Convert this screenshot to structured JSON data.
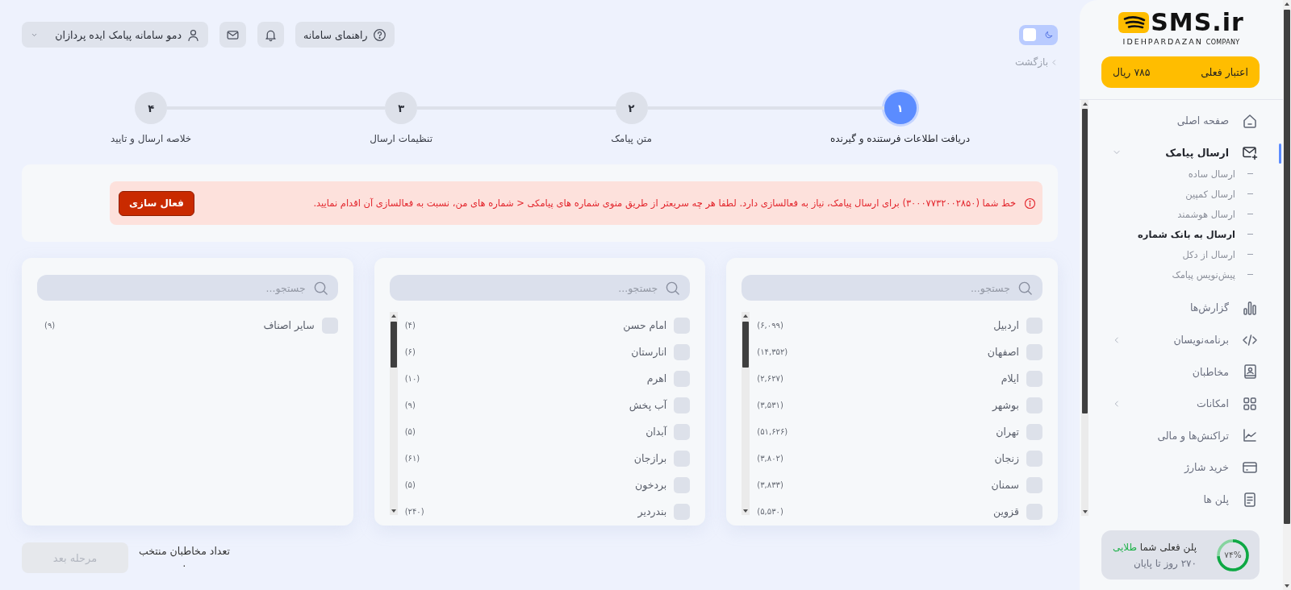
{
  "header": {
    "theme_toggle": {
      "on": false
    },
    "help_button": {
      "label": "راهنمای سامانه"
    },
    "user_menu": {
      "label": "دمو سامانه پیامک ایده پردازان"
    }
  },
  "back_link": {
    "label": "بازگشت"
  },
  "stepper": {
    "steps": [
      {
        "number": "۱",
        "label": "دریافت اطلاعات فرستنده و گیرنده",
        "selected": true
      },
      {
        "number": "۲",
        "label": "متن پیامک",
        "selected": false
      },
      {
        "number": "۳",
        "label": "تنظیمات ارسال",
        "selected": false
      },
      {
        "number": "۴",
        "label": "خلاصه ارسال و تایید",
        "selected": false
      }
    ]
  },
  "alert": {
    "message": "خط شما (۳۰۰۰۷۷۳۲۰۰۲۸۵۰) برای ارسال پیامک، نیاز به فعالسازی دارد. لطفا هر چه سریعتر از طریق منوی شماره های پیامکی < شماره های من، نسبت به فعالسازی آن اقدام نمایید.",
    "button": "فعال سازی"
  },
  "lists": [
    {
      "search": {
        "placeholder": "جستجو..."
      },
      "scrollable": true,
      "items": [
        {
          "name": "اردبیل",
          "count": "(۶,۰۹۹)",
          "checked": false
        },
        {
          "name": "اصفهان",
          "count": "(۱۴,۳۵۲)",
          "checked": false
        },
        {
          "name": "ایلام",
          "count": "(۲,۶۲۷)",
          "checked": false
        },
        {
          "name": "بوشهر",
          "count": "(۳,۵۳۱)",
          "checked": false
        },
        {
          "name": "تهران",
          "count": "(۵۱,۶۲۶)",
          "checked": false
        },
        {
          "name": "زنجان",
          "count": "(۳,۸۰۲)",
          "checked": false
        },
        {
          "name": "سمنان",
          "count": "(۳,۸۳۳)",
          "checked": false
        },
        {
          "name": "قزوین",
          "count": "(۵,۵۳۰)",
          "checked": false
        }
      ]
    },
    {
      "search": {
        "placeholder": "جستجو..."
      },
      "scrollable": true,
      "items": [
        {
          "name": "امام حسن",
          "count": "(۴)",
          "checked": false
        },
        {
          "name": "انارستان",
          "count": "(۶)",
          "checked": false
        },
        {
          "name": "اهرم",
          "count": "(۱۰)",
          "checked": false
        },
        {
          "name": "آب پخش",
          "count": "(۹)",
          "checked": false
        },
        {
          "name": "آبدان",
          "count": "(۵)",
          "checked": false
        },
        {
          "name": "برازجان",
          "count": "(۶۱)",
          "checked": false
        },
        {
          "name": "بردخون",
          "count": "(۵)",
          "checked": false
        },
        {
          "name": "بندردیر",
          "count": "(۲۴۰)",
          "checked": false
        }
      ]
    },
    {
      "search": {
        "placeholder": "جستجو..."
      },
      "scrollable": false,
      "items": [
        {
          "name": "سایر اصناف",
          "count": "(۹)",
          "checked": false
        }
      ]
    }
  ],
  "footer": {
    "selected_count": {
      "label": "تعداد مخاطبان منتخب",
      "value": "۰"
    },
    "next_button": {
      "label": "مرحله بعد",
      "disabled": true
    }
  },
  "sidebar": {
    "logo": {
      "name": "SMS.ir",
      "tagline": "IDEHPARDAZAN",
      "suffix": "COMPANY"
    },
    "balance": {
      "label": "اعتبار فعلی",
      "value": "۷۸۵ ریال"
    },
    "menu": [
      {
        "label": "صفحه اصلی",
        "selected": false
      },
      {
        "label": "ارسال پیامک",
        "selected": true,
        "expanded": true,
        "children": [
          {
            "label": "ارسال ساده",
            "selected": false
          },
          {
            "label": "ارسال کمپین",
            "selected": false
          },
          {
            "label": "ارسال هوشمند",
            "selected": false
          },
          {
            "label": "ارسال به بانک شماره",
            "selected": true
          },
          {
            "label": "ارسال از دکل",
            "selected": false
          },
          {
            "label": "پیش‌نویس پیامک",
            "selected": false
          }
        ]
      },
      {
        "label": "گزارش‌ها",
        "selected": false
      },
      {
        "label": "برنامه‌نویسان",
        "selected": false,
        "expanded": false
      },
      {
        "label": "مخاطبان",
        "selected": false
      },
      {
        "label": "امکانات",
        "selected": false,
        "expanded": false
      },
      {
        "label": "تراکنش‌ها و مالی",
        "selected": false
      },
      {
        "label": "خرید شارژ",
        "selected": false
      },
      {
        "label": "پلن ها",
        "selected": false
      }
    ],
    "plan": {
      "text": "پلن فعلی شما **طلایی**",
      "remaining": "۲۷۰ روز تا پایان",
      "percent": "۷۴%",
      "level": 0.74
    }
  }
}
